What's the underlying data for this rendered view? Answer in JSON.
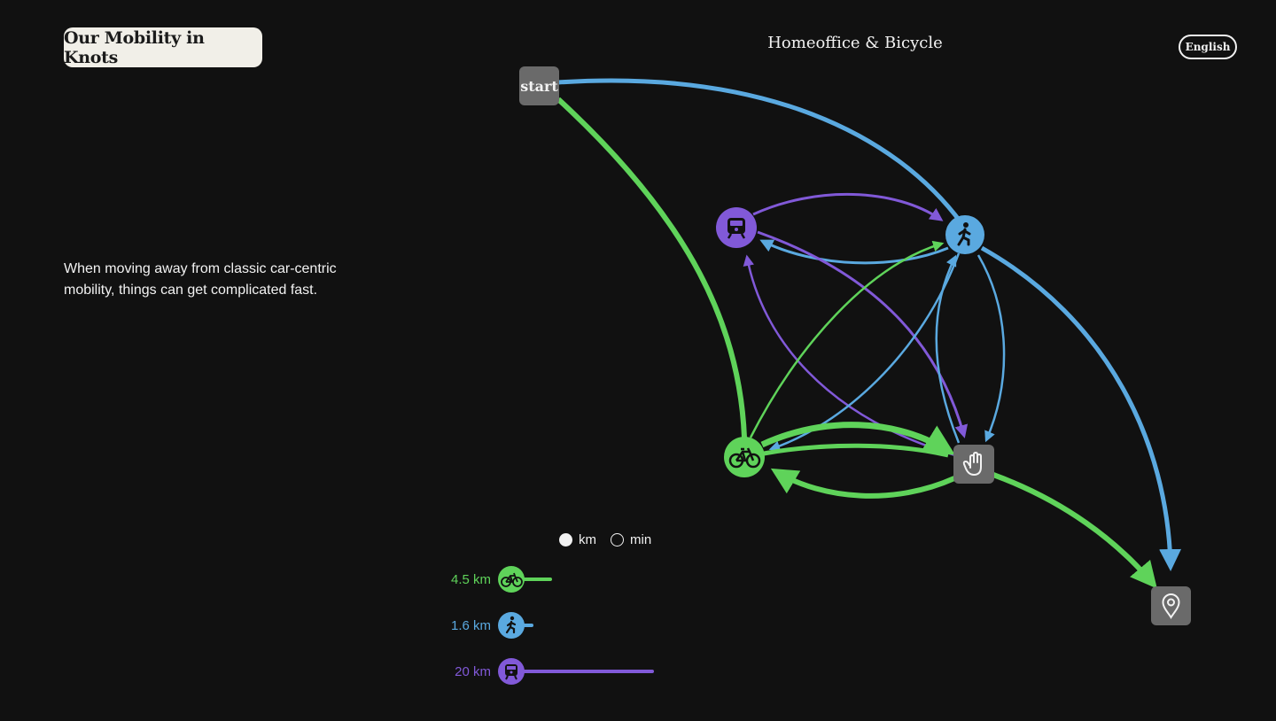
{
  "header": {
    "app_title": "Our Mobility in Knots",
    "scenario_title": "Homeoffice & Bicycle",
    "language_label": "English"
  },
  "description": "When moving away from classic car-centric mobility, things can get complicated fast.",
  "colors": {
    "background": "#111111",
    "bicycle": "#5fd35a",
    "walk": "#5aa9e0",
    "transit": "#8159d8",
    "neutral_node": "#6a6a6a",
    "title_box": "#f1efe8"
  },
  "diagram": {
    "nodes": [
      {
        "id": "start",
        "label": "start",
        "kind": "square"
      },
      {
        "id": "transit",
        "icon": "train-icon",
        "kind": "circle",
        "color": "#8159d8"
      },
      {
        "id": "walk",
        "icon": "walking-person-icon",
        "kind": "circle",
        "color": "#5aa9e0"
      },
      {
        "id": "bicycle",
        "icon": "bicycle-icon",
        "kind": "circle",
        "color": "#5fd35a"
      },
      {
        "id": "stop",
        "icon": "hand-stop-icon",
        "kind": "square"
      },
      {
        "id": "destination",
        "icon": "location-pin-icon",
        "kind": "square"
      }
    ],
    "edges": [
      {
        "from": "start",
        "to": "walk",
        "mode": "walk"
      },
      {
        "from": "start",
        "to": "bicycle",
        "mode": "bicycle"
      },
      {
        "from": "walk",
        "to": "destination",
        "mode": "walk"
      },
      {
        "from": "transit",
        "to": "walk",
        "mode": "transit"
      },
      {
        "from": "walk",
        "to": "transit",
        "mode": "walk"
      },
      {
        "from": "transit",
        "to": "stop",
        "mode": "transit"
      },
      {
        "from": "stop",
        "to": "transit",
        "mode": "transit"
      },
      {
        "from": "bicycle",
        "to": "walk",
        "mode": "bicycle"
      },
      {
        "from": "walk",
        "to": "bicycle",
        "mode": "walk"
      },
      {
        "from": "walk",
        "to": "stop",
        "mode": "walk"
      },
      {
        "from": "stop",
        "to": "walk",
        "mode": "walk"
      },
      {
        "from": "bicycle",
        "to": "stop",
        "mode": "bicycle"
      },
      {
        "from": "stop",
        "to": "bicycle",
        "mode": "bicycle"
      },
      {
        "from": "stop",
        "to": "destination",
        "mode": "bicycle"
      }
    ]
  },
  "units": {
    "options": [
      "km",
      "min"
    ],
    "selected": "km"
  },
  "legend": [
    {
      "mode": "bicycle",
      "value": "4.5 km",
      "km": 4.5,
      "icon": "bicycle-icon",
      "color": "#5fd35a"
    },
    {
      "mode": "walk",
      "value": "1.6 km",
      "km": 1.6,
      "icon": "walking-person-icon",
      "color": "#5aa9e0"
    },
    {
      "mode": "transit",
      "value": "20 km",
      "km": 20,
      "icon": "train-icon",
      "color": "#8159d8"
    }
  ]
}
